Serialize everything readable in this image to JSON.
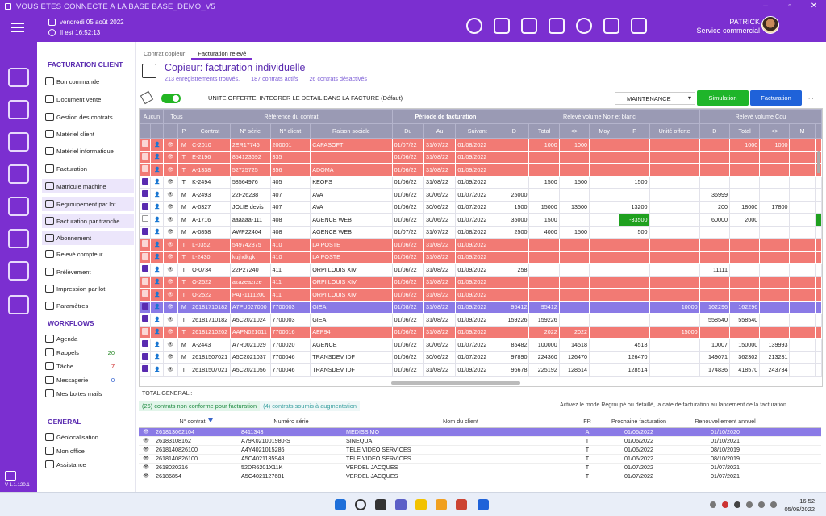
{
  "titlebar": {
    "title": "VOUS ETES CONNECTE A LA BASE BASE_DEMO_V5"
  },
  "header": {
    "date": "vendredi 05 août 2022",
    "time": "Il est 16:52:13",
    "user_name": "PATRICK",
    "user_role": "Service commercial"
  },
  "sidebar": {
    "version": "V 1.1.120.1"
  },
  "menu": {
    "sections": [
      {
        "title": "FACTURATION CLIENT",
        "items": [
          {
            "label": "Bon commande",
            "icon": "cart-icon"
          },
          {
            "label": "Document vente",
            "icon": "document-icon"
          },
          {
            "label": "Gestion des contrats",
            "icon": "contract-icon"
          },
          {
            "label": "Matériel client",
            "icon": "device-icon"
          },
          {
            "label": "Matériel informatique",
            "icon": "computer-icon"
          },
          {
            "label": "Facturation",
            "icon": "invoice-icon"
          },
          {
            "label": "Matricule machine",
            "icon": "machine-icon",
            "selected": true
          },
          {
            "label": "Regroupement par lot",
            "icon": "group-icon",
            "selected": true
          },
          {
            "label": "Facturation  par tranche",
            "icon": "tranche-icon",
            "selected": true
          },
          {
            "label": "Abonnement",
            "icon": "tools-icon",
            "selected": true
          },
          {
            "label": "Relevé compteur",
            "icon": "counter-icon"
          },
          {
            "label": "Prélèvement",
            "icon": "bank-icon"
          },
          {
            "label": "Impression par lot",
            "icon": "printer-icon"
          },
          {
            "label": "Paramètres",
            "icon": "gear-icon"
          }
        ]
      },
      {
        "title": "WORKFLOWS",
        "items": [
          {
            "label": "Agenda",
            "icon": "calendar-icon"
          },
          {
            "label": "Rappels",
            "icon": "reminder-icon",
            "count": "20"
          },
          {
            "label": "Tâche",
            "icon": "task-icon",
            "count": "7"
          },
          {
            "label": "Messagerie",
            "icon": "message-icon",
            "count": "0"
          },
          {
            "label": "Mes boites mails",
            "icon": "mailbox-icon"
          }
        ]
      },
      {
        "title": "GENERAL",
        "items": [
          {
            "label": "Géolocalisation",
            "icon": "location-icon"
          },
          {
            "label": "Mon office",
            "icon": "office-icon"
          },
          {
            "label": "Assistance",
            "icon": "assistance-icon"
          }
        ]
      }
    ]
  },
  "tabs": [
    "Contrat copieur",
    "Facturation relevé"
  ],
  "page": {
    "title": "Copieur: facturation individuelle",
    "stat_records": "213 enregistrements trouvés.",
    "stat_active": "187 contrats actifs",
    "stat_inactive": "26 contrats désactivés"
  },
  "toolbar": {
    "option_label": "UNITE OFFERTE: INTEGRER LE DETAIL DANS LA FACTURE (Défaut)",
    "maintenance": "MAINTENANCE",
    "simulation": "Simulation",
    "facturation": "Facturation",
    "more": "..."
  },
  "grid": {
    "group_headers": {
      "aucun": "Aucun",
      "tous": "Tous",
      "reference": "Référence du contrat",
      "periode": "Période de facturation",
      "releve_nb": "Relevé volume Noir et blanc",
      "releve_couleur": "Relevé volume Cou"
    },
    "columns": [
      "P",
      "Contrat",
      "N° série",
      "N° client",
      "Raison sociale",
      "Du",
      "Au",
      "Suivant",
      "D",
      "Total",
      "<>",
      "Moy",
      "F",
      "Unité offerte",
      "D",
      "Total",
      "<>",
      "M"
    ],
    "rows": [
      {
        "style": "red",
        "cb": true,
        "p": "M",
        "contrat": "C-2010",
        "serie": "2ER17746",
        "client": "200001",
        "raison": "CAPASOFT",
        "du": "01/07/22",
        "au": "31/07/22",
        "suiv": "01/08/2022",
        "d": "",
        "total": "1000",
        "diff": "1000",
        "moy": "",
        "f": "",
        "uo": "",
        "d2": "",
        "total2": "1000",
        "diff2": "1000",
        "m2": ""
      },
      {
        "style": "red",
        "cb": true,
        "p": "T",
        "contrat": "E-2196",
        "serie": "854123692",
        "client": "335",
        "raison": "",
        "du": "01/06/22",
        "au": "31/08/22",
        "suiv": "01/09/2022",
        "d": "",
        "total": "",
        "diff": "",
        "moy": "",
        "f": "",
        "uo": "",
        "d2": "",
        "total2": "",
        "diff2": "",
        "m2": ""
      },
      {
        "style": "red",
        "cb": true,
        "p": "T",
        "contrat": "A-1338",
        "serie": "52725725",
        "client": "356",
        "raison": "ADOMA",
        "du": "01/06/22",
        "au": "31/08/22",
        "suiv": "01/09/2022",
        "d": "",
        "total": "",
        "diff": "",
        "moy": "",
        "f": "",
        "uo": "",
        "d2": "",
        "total2": "",
        "diff2": "",
        "m2": ""
      },
      {
        "style": "white",
        "cb": true,
        "p": "T",
        "contrat": "K-2494",
        "serie": "58564976",
        "client": "405",
        "raison": "KEOPS",
        "du": "01/06/22",
        "au": "31/08/22",
        "suiv": "01/09/2022",
        "d": "",
        "total": "1500",
        "diff": "1500",
        "moy": "",
        "f": "1500",
        "uo": "",
        "d2": "",
        "total2": "",
        "diff2": "",
        "m2": ""
      },
      {
        "style": "white",
        "cb": true,
        "p": "M",
        "contrat": "A-2493",
        "serie": "22F26238",
        "client": "407",
        "raison": "AVA",
        "du": "01/06/22",
        "au": "30/06/22",
        "suiv": "01/07/2022",
        "d": "25000",
        "total": "",
        "diff": "",
        "moy": "",
        "f": "",
        "uo": "",
        "d2": "36999",
        "total2": "",
        "diff2": "",
        "m2": ""
      },
      {
        "style": "white",
        "cb": true,
        "p": "M",
        "contrat": "A-0327",
        "serie": "JOLIE  devis",
        "client": "407",
        "raison": "AVA",
        "du": "01/06/22",
        "au": "30/06/22",
        "suiv": "01/07/2022",
        "d": "1500",
        "total": "15000",
        "diff": "13500",
        "moy": "",
        "f": "13200",
        "uo": "",
        "d2": "200",
        "total2": "18000",
        "diff2": "17800",
        "m2": ""
      },
      {
        "style": "white",
        "cb": false,
        "p": "M",
        "contrat": "A-1716",
        "serie": "aaaaaa-111",
        "client": "408",
        "raison": "AGENCE WEB",
        "du": "01/06/22",
        "au": "30/06/22",
        "suiv": "01/07/2022",
        "d": "35000",
        "total": "1500",
        "diff": "",
        "moy": "",
        "f": "-33500",
        "fgreen": true,
        "uo": "",
        "d2": "60000",
        "total2": "2000",
        "diff2": "",
        "m2": "",
        "gbar": true
      },
      {
        "style": "white",
        "cb": true,
        "p": "M",
        "contrat": "A-0858",
        "serie": "AWP22404",
        "client": "408",
        "raison": "AGENCE WEB",
        "du": "01/07/22",
        "au": "31/07/22",
        "suiv": "01/08/2022",
        "d": "2500",
        "total": "4000",
        "diff": "1500",
        "moy": "",
        "f": "500",
        "uo": "",
        "d2": "",
        "total2": "",
        "diff2": "",
        "m2": ""
      },
      {
        "style": "red",
        "cb": true,
        "p": "T",
        "contrat": "L-0352",
        "serie": "549742375",
        "client": "410",
        "raison": "LA POSTE",
        "du": "01/06/22",
        "au": "31/08/22",
        "suiv": "01/09/2022",
        "d": "",
        "total": "",
        "diff": "",
        "moy": "",
        "f": "",
        "uo": "",
        "d2": "",
        "total2": "",
        "diff2": "",
        "m2": ""
      },
      {
        "style": "red",
        "cb": true,
        "p": "T",
        "contrat": "L-2430",
        "serie": "kujhdkgk",
        "client": "410",
        "raison": "LA POSTE",
        "du": "01/06/22",
        "au": "31/08/22",
        "suiv": "01/09/2022",
        "d": "",
        "total": "",
        "diff": "",
        "moy": "",
        "f": "",
        "uo": "",
        "d2": "",
        "total2": "",
        "diff2": "",
        "m2": ""
      },
      {
        "style": "white",
        "cb": true,
        "p": "T",
        "contrat": "O-0734",
        "serie": "22P27240",
        "client": "411",
        "raison": "ORPI LOUIS XIV",
        "du": "01/06/22",
        "au": "31/08/22",
        "suiv": "01/09/2022",
        "d": "258",
        "total": "",
        "diff": "",
        "moy": "",
        "f": "",
        "uo": "",
        "d2": "11111",
        "total2": "",
        "diff2": "",
        "m2": ""
      },
      {
        "style": "red",
        "cb": true,
        "p": "T",
        "contrat": "O-2522",
        "serie": "azazeazrze",
        "client": "411",
        "raison": "ORPI LOUIS XIV",
        "du": "01/06/22",
        "au": "31/08/22",
        "suiv": "01/09/2022",
        "d": "",
        "total": "",
        "diff": "",
        "moy": "",
        "f": "",
        "uo": "",
        "d2": "",
        "total2": "",
        "diff2": "",
        "m2": ""
      },
      {
        "style": "red",
        "cb": true,
        "p": "T",
        "contrat": "O-2522",
        "serie": "PAT-1111200",
        "client": "411",
        "raison": "ORPI LOUIS XIV",
        "du": "01/06/22",
        "au": "31/08/22",
        "suiv": "01/09/2022",
        "d": "",
        "total": "",
        "diff": "",
        "moy": "",
        "f": "",
        "uo": "",
        "d2": "",
        "total2": "",
        "diff2": "",
        "m2": ""
      },
      {
        "style": "blue",
        "cb": true,
        "p": "M",
        "contrat": "26181710182",
        "serie": "A7PU027000",
        "client": "7700003",
        "raison": "GIEA",
        "du": "01/08/22",
        "au": "31/08/22",
        "suiv": "01/09/2022",
        "d": "95412",
        "total": "95412",
        "diff": "",
        "moy": "",
        "f": "",
        "uo": "10000",
        "d2": "162296",
        "total2": "162296",
        "diff2": "",
        "m2": ""
      },
      {
        "style": "white",
        "cb": true,
        "p": "T",
        "contrat": "26181710182",
        "serie": "A5C2021024",
        "client": "7700003",
        "raison": "GIEA",
        "du": "01/06/22",
        "au": "31/08/22",
        "suiv": "01/09/2022",
        "d": "159226",
        "total": "159226",
        "diff": "",
        "moy": "",
        "f": "",
        "uo": "",
        "d2": "558540",
        "total2": "558540",
        "diff2": "",
        "m2": ""
      },
      {
        "style": "red",
        "cb": true,
        "p": "T",
        "contrat": "26181210202",
        "serie": "AAPN021011",
        "client": "7700016",
        "raison": "AEP94",
        "du": "01/06/22",
        "au": "31/08/22",
        "suiv": "01/09/2022",
        "d": "",
        "total": "2022",
        "diff": "2022",
        "moy": "",
        "f": "",
        "uo": "15000",
        "uo2": "15000",
        "d2": "",
        "total2": "",
        "diff2": "",
        "m2": ""
      },
      {
        "style": "white",
        "cb": true,
        "p": "M",
        "contrat": "A-2443",
        "serie": "A7R0021029",
        "client": "7700020",
        "raison": "AGENCE",
        "du": "01/06/22",
        "au": "30/06/22",
        "suiv": "01/07/2022",
        "d": "85482",
        "total": "100000",
        "diff": "14518",
        "moy": "",
        "f": "4518",
        "uo": "",
        "d2": "10007",
        "total2": "150000",
        "diff2": "139993",
        "m2": ""
      },
      {
        "style": "white",
        "cb": true,
        "p": "M",
        "contrat": "26181507021",
        "serie": "A5C2021037",
        "client": "7700046",
        "raison": "TRANSDEV IDF",
        "du": "01/06/22",
        "au": "30/06/22",
        "suiv": "01/07/2022",
        "d": "97890",
        "total": "224360",
        "diff": "126470",
        "moy": "",
        "f": "126470",
        "uo": "",
        "d2": "149071",
        "total2": "362302",
        "diff2": "213231",
        "m2": ""
      },
      {
        "style": "white",
        "cb": true,
        "p": "T",
        "contrat": "26181507021",
        "serie": "A5C2021056",
        "client": "7700046",
        "raison": "TRANSDEV IDF",
        "du": "01/06/22",
        "au": "31/08/22",
        "suiv": "01/09/2022",
        "d": "96678",
        "total": "225192",
        "diff": "128514",
        "moy": "",
        "f": "128514",
        "uo": "",
        "d2": "174836",
        "total2": "418570",
        "diff2": "243734",
        "m2": ""
      }
    ]
  },
  "total_general": "TOTAL GENERAL :",
  "chips": {
    "nonconform": "(26) contrats non conforme pour facturation",
    "augment": "(4) contrats soumis à augmentation"
  },
  "hint": "Activez le mode Regroupé ou détaillé, la date de facturation au lancement de la facturation",
  "bottom": {
    "columns": [
      "N° contrat",
      "Numéro série",
      "Nom du client",
      "FR",
      "Prochaine facturation",
      "Renouvellement annuel"
    ],
    "rows": [
      {
        "contrat": "26181306210​4",
        "serie": "8411343",
        "client": "MEDISSIMO",
        "fr": "A",
        "next": "01/06/2022",
        "renew": "01/10/2020",
        "sel": true
      },
      {
        "contrat": "26183108162",
        "serie": "A79K021001980-S",
        "client": "SINEQUA",
        "fr": "T",
        "next": "01/06/2022",
        "renew": "01/10/2021"
      },
      {
        "contrat": "26181408261​00",
        "serie": "A4Y4021015286",
        "client": "TELE VIDEO SERVICES",
        "fr": "T",
        "next": "01/06/2022",
        "renew": "08/10/2019"
      },
      {
        "contrat": "26181408261​00",
        "serie": "A5C4021135948",
        "client": "TELE VIDEO SERVICES",
        "fr": "T",
        "next": "01/06/2022",
        "renew": "08/10/2019"
      },
      {
        "contrat": "26180202​16",
        "serie": "52DR6201X11K",
        "client": "VERDEL JACQUES",
        "fr": "T",
        "next": "01/07/2022",
        "renew": "01/07/2021"
      },
      {
        "contrat": "26186854",
        "serie": "A5C4021127681",
        "client": "VERDEL JACQUES",
        "fr": "T",
        "next": "01/07/2022",
        "renew": "01/07/2021"
      }
    ]
  },
  "taskbar": {
    "time": "16:52",
    "date": "05/08/2022"
  }
}
